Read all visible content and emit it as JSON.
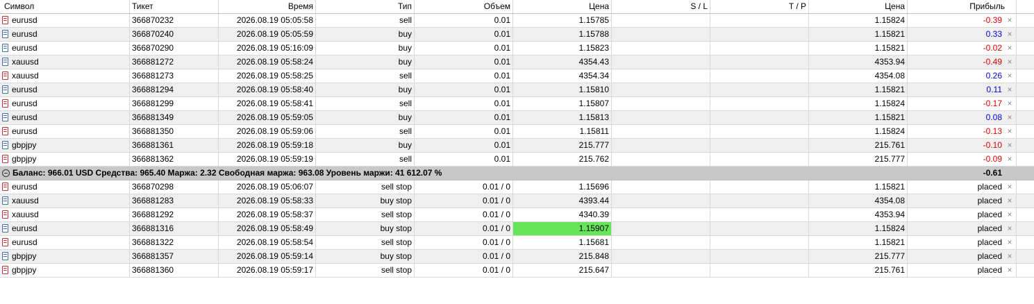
{
  "headers": {
    "symbol": "Символ",
    "ticket": "Тикет",
    "time": "Время",
    "type": "Тип",
    "volume": "Объем",
    "price": "Цена",
    "sl": "S / L",
    "tp": "T / P",
    "price2": "Цена",
    "profit": "Прибыль"
  },
  "positions": [
    {
      "symbol": "eurusd",
      "icon": "red",
      "ticket": "366870232",
      "time": "2026.08.19 05:05:58",
      "type": "sell",
      "volume": "0.01",
      "price": "1.15785",
      "sl": "",
      "tp": "",
      "current": "1.15824",
      "profit": "-0.39",
      "sign": "neg"
    },
    {
      "symbol": "eurusd",
      "icon": "blue",
      "ticket": "366870240",
      "time": "2026.08.19 05:05:59",
      "type": "buy",
      "volume": "0.01",
      "price": "1.15788",
      "sl": "",
      "tp": "",
      "current": "1.15821",
      "profit": "0.33",
      "sign": "pos"
    },
    {
      "symbol": "eurusd",
      "icon": "blue",
      "ticket": "366870290",
      "time": "2026.08.19 05:16:09",
      "type": "buy",
      "volume": "0.01",
      "price": "1.15823",
      "sl": "",
      "tp": "",
      "current": "1.15821",
      "profit": "-0.02",
      "sign": "neg"
    },
    {
      "symbol": "xauusd",
      "icon": "blue",
      "ticket": "366881272",
      "time": "2026.08.19 05:58:24",
      "type": "buy",
      "volume": "0.01",
      "price": "4354.43",
      "sl": "",
      "tp": "",
      "current": "4353.94",
      "profit": "-0.49",
      "sign": "neg"
    },
    {
      "symbol": "xauusd",
      "icon": "red",
      "ticket": "366881273",
      "time": "2026.08.19 05:58:25",
      "type": "sell",
      "volume": "0.01",
      "price": "4354.34",
      "sl": "",
      "tp": "",
      "current": "4354.08",
      "profit": "0.26",
      "sign": "pos"
    },
    {
      "symbol": "eurusd",
      "icon": "blue",
      "ticket": "366881294",
      "time": "2026.08.19 05:58:40",
      "type": "buy",
      "volume": "0.01",
      "price": "1.15810",
      "sl": "",
      "tp": "",
      "current": "1.15821",
      "profit": "0.11",
      "sign": "pos"
    },
    {
      "symbol": "eurusd",
      "icon": "red",
      "ticket": "366881299",
      "time": "2026.08.19 05:58:41",
      "type": "sell",
      "volume": "0.01",
      "price": "1.15807",
      "sl": "",
      "tp": "",
      "current": "1.15824",
      "profit": "-0.17",
      "sign": "neg"
    },
    {
      "symbol": "eurusd",
      "icon": "blue",
      "ticket": "366881349",
      "time": "2026.08.19 05:59:05",
      "type": "buy",
      "volume": "0.01",
      "price": "1.15813",
      "sl": "",
      "tp": "",
      "current": "1.15821",
      "profit": "0.08",
      "sign": "pos"
    },
    {
      "symbol": "eurusd",
      "icon": "red",
      "ticket": "366881350",
      "time": "2026.08.19 05:59:06",
      "type": "sell",
      "volume": "0.01",
      "price": "1.15811",
      "sl": "",
      "tp": "",
      "current": "1.15824",
      "profit": "-0.13",
      "sign": "neg"
    },
    {
      "symbol": "gbpjpy",
      "icon": "blue",
      "ticket": "366881361",
      "time": "2026.08.19 05:59:18",
      "type": "buy",
      "volume": "0.01",
      "price": "215.777",
      "sl": "",
      "tp": "",
      "current": "215.761",
      "profit": "-0.10",
      "sign": "neg"
    },
    {
      "symbol": "gbpjpy",
      "icon": "red",
      "ticket": "366881362",
      "time": "2026.08.19 05:59:19",
      "type": "sell",
      "volume": "0.01",
      "price": "215.762",
      "sl": "",
      "tp": "",
      "current": "215.777",
      "profit": "-0.09",
      "sign": "neg"
    }
  ],
  "summary": {
    "text": "Баланс: 966.01 USD  Средства: 965.40  Маржа: 2.32  Свободная маржа: 963.08  Уровень маржи: 41 612.07 %",
    "total": "-0.61"
  },
  "orders": [
    {
      "symbol": "eurusd",
      "icon": "red",
      "ticket": "366870298",
      "time": "2026.08.19 05:06:07",
      "type": "sell stop",
      "volume": "0.01 / 0",
      "price": "1.15696",
      "current": "1.15821",
      "status": "placed",
      "highlight": false
    },
    {
      "symbol": "xauusd",
      "icon": "blue",
      "ticket": "366881283",
      "time": "2026.08.19 05:58:33",
      "type": "buy stop",
      "volume": "0.01 / 0",
      "price": "4393.44",
      "current": "4354.08",
      "status": "placed",
      "highlight": false
    },
    {
      "symbol": "xauusd",
      "icon": "red",
      "ticket": "366881292",
      "time": "2026.08.19 05:58:37",
      "type": "sell stop",
      "volume": "0.01 / 0",
      "price": "4340.39",
      "current": "4353.94",
      "status": "placed",
      "highlight": false
    },
    {
      "symbol": "eurusd",
      "icon": "blue",
      "ticket": "366881316",
      "time": "2026.08.19 05:58:49",
      "type": "buy stop",
      "volume": "0.01 / 0",
      "price": "1.15907",
      "current": "1.15824",
      "status": "placed",
      "highlight": true
    },
    {
      "symbol": "eurusd",
      "icon": "red",
      "ticket": "366881322",
      "time": "2026.08.19 05:58:54",
      "type": "sell stop",
      "volume": "0.01 / 0",
      "price": "1.15681",
      "current": "1.15821",
      "status": "placed",
      "highlight": false
    },
    {
      "symbol": "gbpjpy",
      "icon": "blue",
      "ticket": "366881357",
      "time": "2026.08.19 05:59:14",
      "type": "buy stop",
      "volume": "0.01 / 0",
      "price": "215.848",
      "current": "215.777",
      "status": "placed",
      "highlight": false
    },
    {
      "symbol": "gbpjpy",
      "icon": "red",
      "ticket": "366881360",
      "time": "2026.08.19 05:59:17",
      "type": "sell stop",
      "volume": "0.01 / 0",
      "price": "215.647",
      "current": "215.761",
      "status": "placed",
      "highlight": false
    }
  ],
  "colors": {
    "negative": "#e00000",
    "positive": "#0000e0",
    "highlight": "#66e45a",
    "summary_bg": "#c8c8c8"
  },
  "icons": {
    "sell": "doc-icon-red",
    "buy": "doc-icon-blue",
    "close": "close-icon",
    "collapse": "collapse-icon"
  }
}
